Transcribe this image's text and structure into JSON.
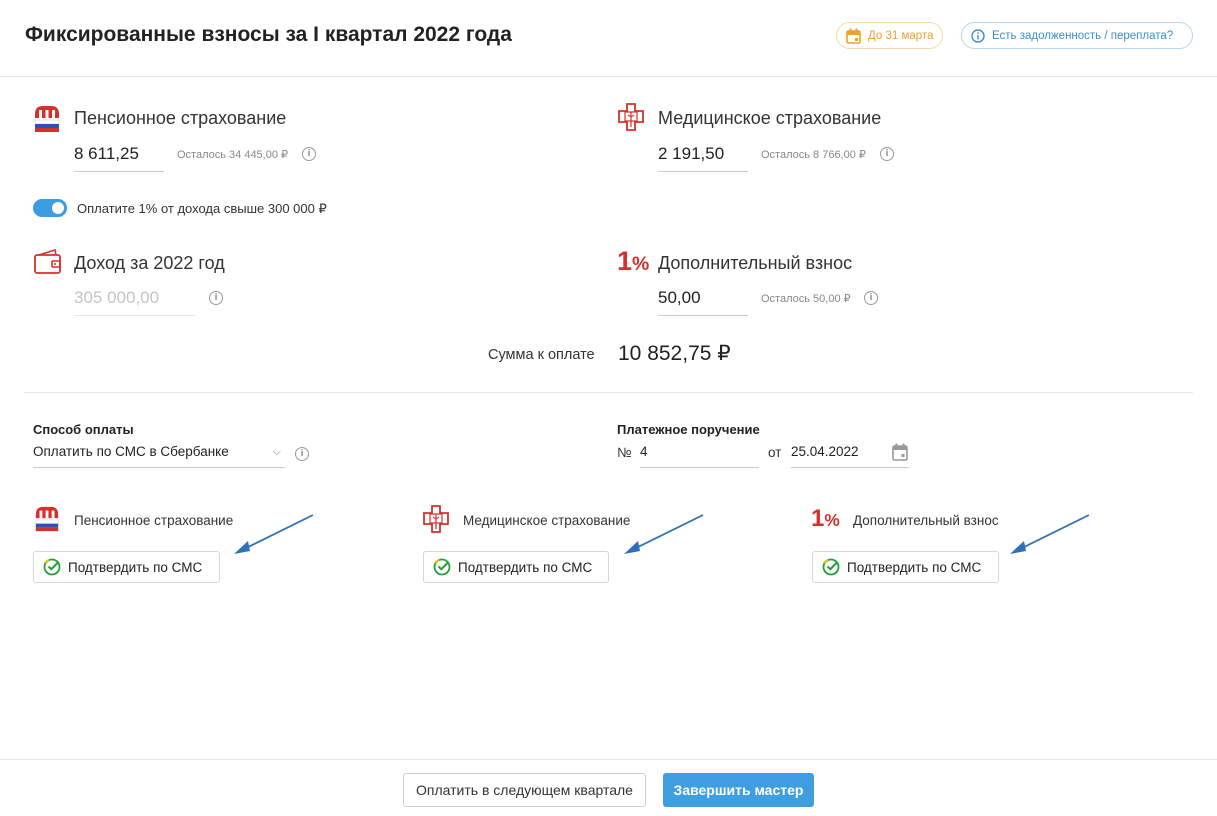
{
  "header": {
    "title": "Фиксированные взносы за I квартал 2022 года",
    "deadline_label": "До 31 марта",
    "debt_label": "Есть задолженность / переплата?"
  },
  "pension": {
    "title": "Пенсионное страхование",
    "value": "8 611,25",
    "remaining": "Осталось 34 445,00 ₽"
  },
  "medical": {
    "title": "Медицинское страхование",
    "value": "2 191,50",
    "remaining": "Осталось 8 766,00 ₽"
  },
  "toggle": {
    "label": "Оплатите 1% от дохода свыше 300 000 ₽",
    "on": true
  },
  "income": {
    "title": "Доход за 2022 год",
    "value": "305 000,00"
  },
  "additional": {
    "icon_text": "1",
    "icon_pct": "%",
    "title": "Дополнительный взнос",
    "value": "50,00",
    "remaining": "Осталось 50,00 ₽"
  },
  "total": {
    "label": "Сумма к оплате",
    "value": "10 852,75 ₽"
  },
  "payment": {
    "method_label": "Способ оплаты",
    "method_value": "Оплатить по СМС в Сбербанке",
    "order_label": "Платежное поручение",
    "number_prefix": "№",
    "number_value": "4",
    "date_prefix": "от",
    "date_value": "25.04.2022"
  },
  "cards": [
    {
      "title": "Пенсионное страхование",
      "button": "Подтвердить по СМС"
    },
    {
      "title": "Медицинское страхование",
      "button": "Подтвердить по СМС"
    },
    {
      "title": "Дополнительный взнос",
      "button": "Подтвердить по СМС"
    }
  ],
  "footer": {
    "next_quarter": "Оплатить в следующем квартале",
    "finish": "Завершить мастер"
  },
  "colors": {
    "accent": "#3e9ee0",
    "brand_red": "#d6302a",
    "warning": "#f0a030"
  },
  "icons": [
    "pfr-logo-icon",
    "medical-cross-icon",
    "wallet-icon",
    "one-percent-icon",
    "calendar-icon",
    "info-icon",
    "sber-check-icon",
    "chevron-down-icon",
    "arrow-icon"
  ]
}
